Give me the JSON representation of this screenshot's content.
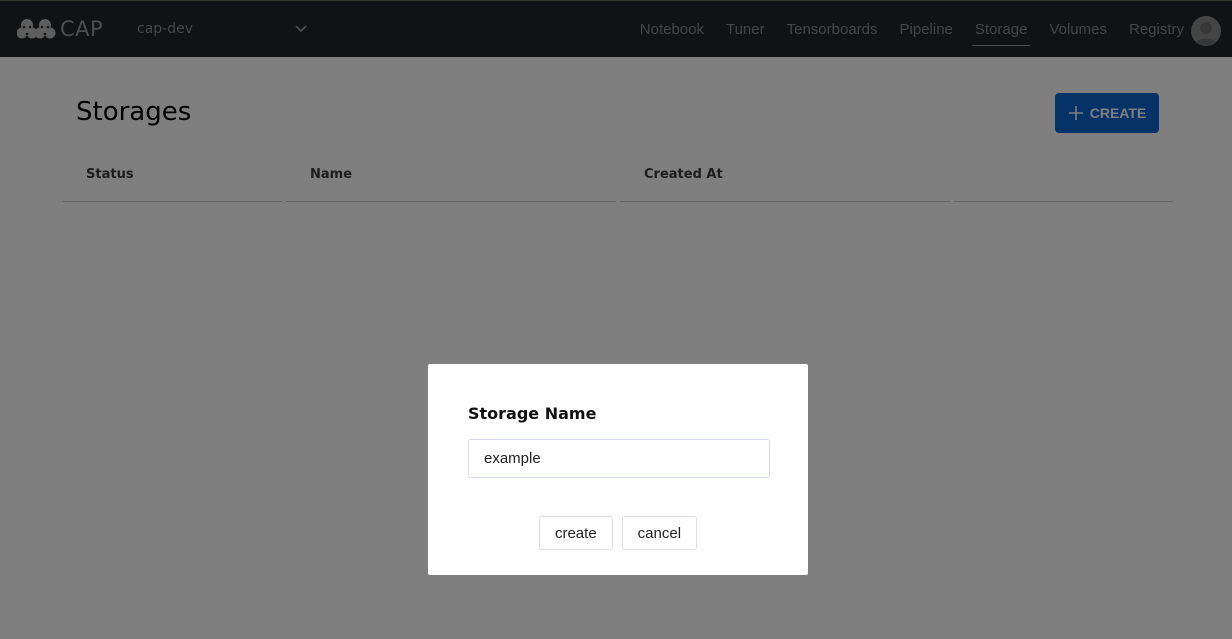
{
  "app": {
    "logo_text": "CAP",
    "project": "cap-dev"
  },
  "nav": {
    "items": [
      {
        "label": "Notebook",
        "active": false
      },
      {
        "label": "Tuner",
        "active": false
      },
      {
        "label": "Tensorboards",
        "active": false
      },
      {
        "label": "Pipeline",
        "active": false
      },
      {
        "label": "Storage",
        "active": true
      },
      {
        "label": "Volumes",
        "active": false
      },
      {
        "label": "Registry",
        "active": false
      }
    ]
  },
  "page": {
    "title": "Storages",
    "create_label": "CREATE",
    "table": {
      "columns": [
        "Status",
        "Name",
        "Created At",
        ""
      ],
      "rows": []
    }
  },
  "modal": {
    "title": "Storage Name",
    "input_value": "example",
    "create_label": "create",
    "cancel_label": "cancel"
  },
  "colors": {
    "topbar": "#212529",
    "primary": "#0a66d0",
    "overlay": "rgba(0,0,0,0.5)"
  }
}
